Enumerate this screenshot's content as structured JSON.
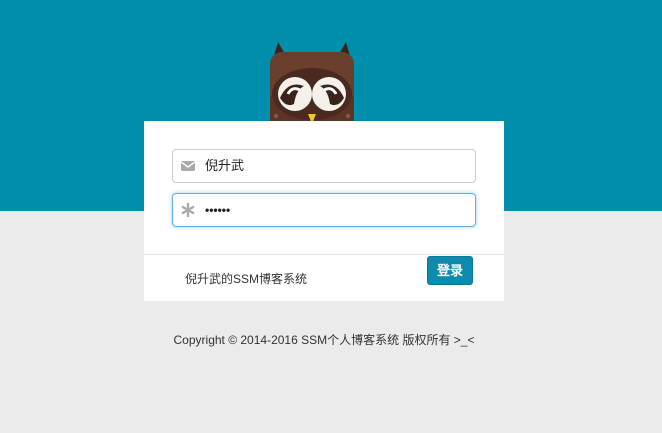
{
  "login_form": {
    "username_value": "倪升武",
    "password_masked": "••••••",
    "username_icon": "envelope-icon",
    "password_icon": "asterisk-icon",
    "system_name": "倪升武的SSM博客系统",
    "login_button_label": "登录"
  },
  "mascot": {
    "icon": "owl-covering-eyes-icon"
  },
  "footer": {
    "copyright": "Copyright © 2014-2016 SSM个人博客系统 版权所有 >_<"
  },
  "colors": {
    "header_background": "#008ead",
    "page_background": "#ebebeb",
    "button_background": "#0d8bad",
    "focus_border": "#66afe9"
  }
}
